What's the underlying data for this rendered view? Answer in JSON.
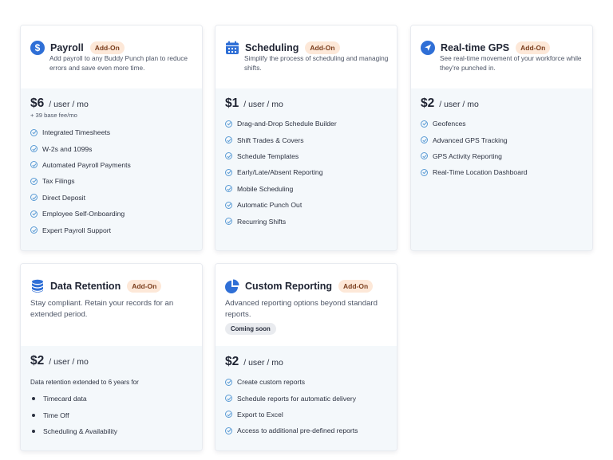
{
  "cards": [
    {
      "icon": "dollar-icon",
      "title": "Payroll",
      "badge": "Add-On",
      "description": "Add payroll to any Buddy Punch plan to reduce errors and save even more time.",
      "price": "$6",
      "unit": "/ user / mo",
      "fee": "+ 39 base fee/mo",
      "features": [
        "Integrated Timesheets",
        "W-2s and 1099s",
        "Automated Payroll Payments",
        "Tax Filings",
        "Direct Deposit",
        "Employee Self-Onboarding",
        "Expert Payroll Support"
      ]
    },
    {
      "icon": "calendar-icon",
      "title": "Scheduling",
      "badge": "Add-On",
      "description": "Simplify the process of scheduling and managing shifts.",
      "price": "$1",
      "unit": "/ user / mo",
      "features": [
        "Drag-and-Drop Schedule Builder",
        "Shift Trades & Covers",
        "Schedule Templates",
        "Early/Late/Absent Reporting",
        "Mobile Scheduling",
        "Automatic Punch Out",
        "Recurring Shifts"
      ]
    },
    {
      "icon": "location-arrow-icon",
      "title": "Real-time GPS",
      "badge": "Add-On",
      "description": "See real-time movement of your workforce while they're punched in.",
      "price": "$2",
      "unit": "/ user / mo",
      "features": [
        "Geofences",
        "Advanced GPS Tracking",
        "GPS Activity Reporting",
        "Real-Time Location Dashboard"
      ]
    },
    {
      "icon": "database-icon",
      "title": "Data Retention",
      "badge": "Add-On",
      "description": "Stay compliant. Retain your records for an extended period.",
      "price": "$2",
      "unit": "/ user / mo",
      "note": "Data retention extended to 6 years for",
      "bullets": [
        "Timecard data",
        "Time Off",
        "Scheduling & Availability"
      ]
    },
    {
      "icon": "pie-chart-icon",
      "title": "Custom Reporting",
      "badge": "Add-On",
      "description": "Advanced reporting options beyond standard reports.",
      "status": "Coming soon",
      "price": "$2",
      "unit": "/ user / mo",
      "features": [
        "Create custom reports",
        "Schedule reports for automatic delivery",
        "Export to Excel",
        "Access to additional pre-defined reports"
      ]
    }
  ],
  "colors": {
    "icon_blue": "#2f6fd6",
    "badge_bg": "#fde8d8",
    "check_blue": "#5a9bd5",
    "body_bg": "#f4f8fb"
  }
}
